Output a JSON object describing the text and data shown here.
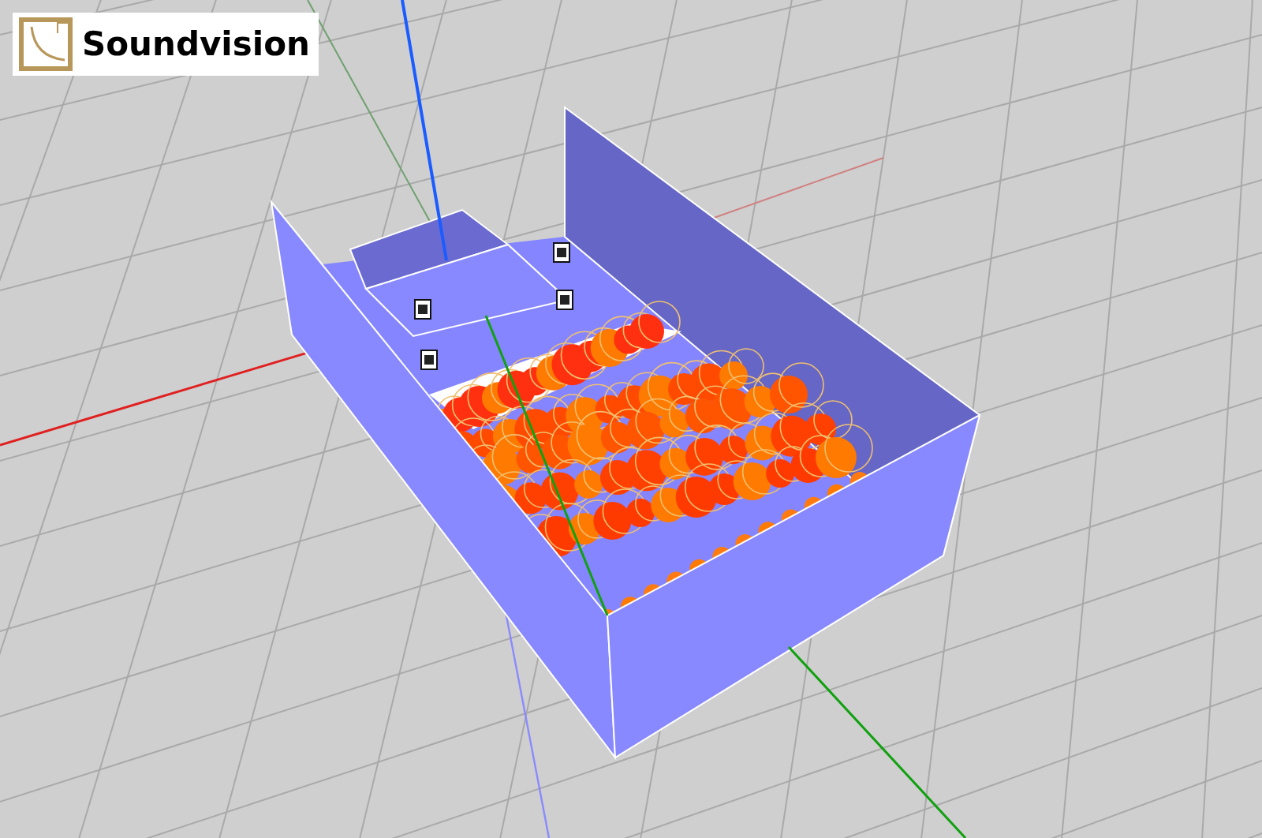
{
  "logo": {
    "text": "Soundvision"
  }
}
